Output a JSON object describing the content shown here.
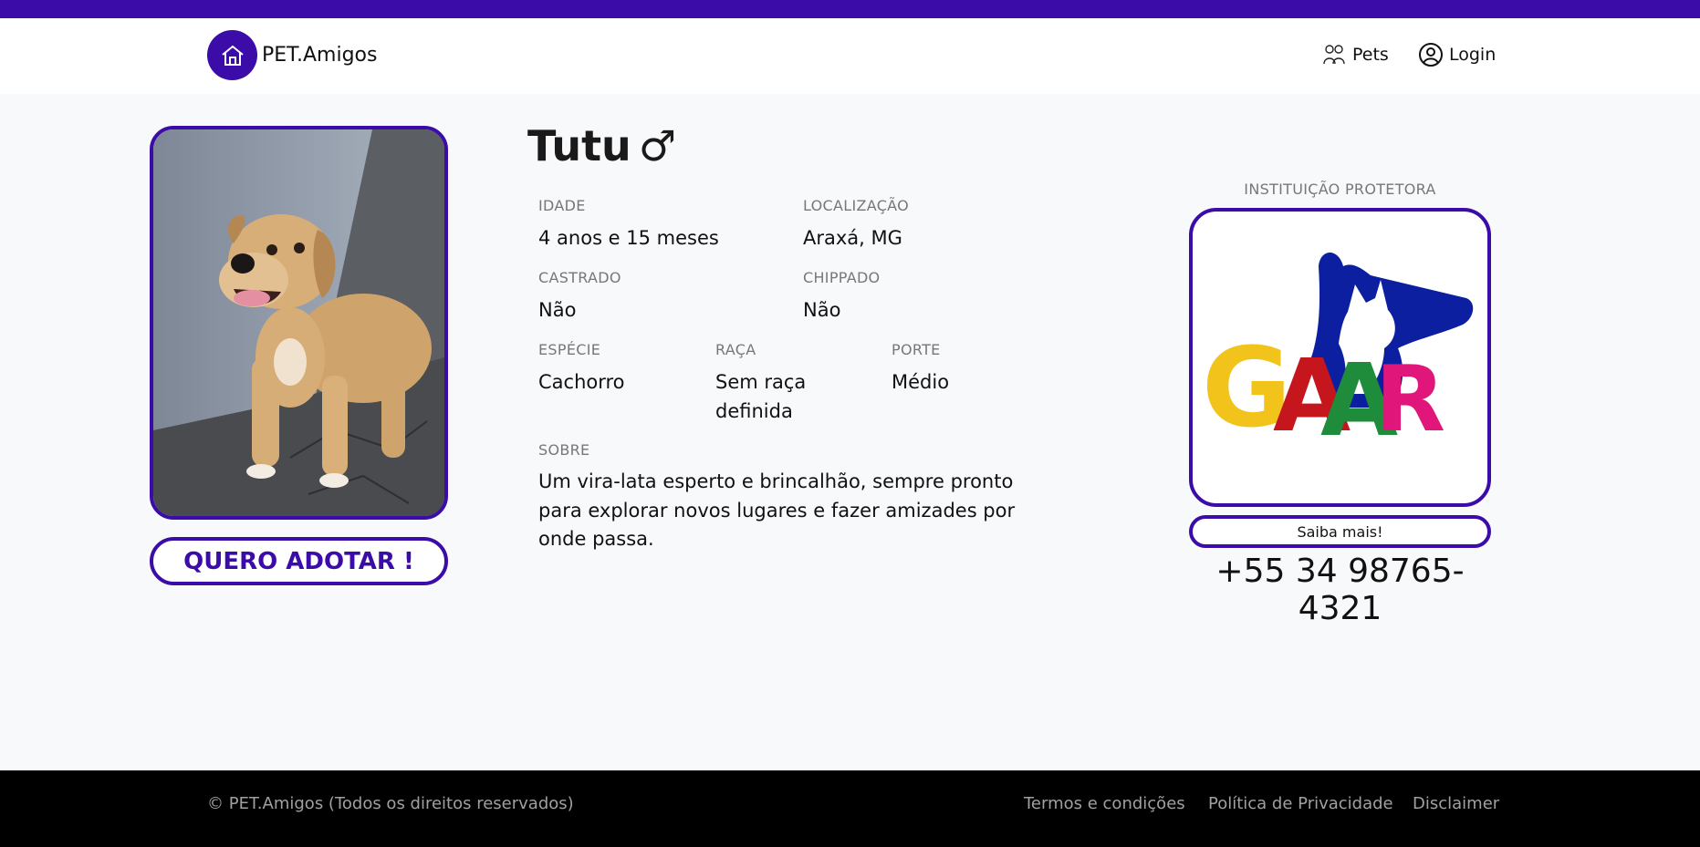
{
  "header": {
    "brand_name": "PET.Amigos",
    "nav": {
      "pets_label": "Pets",
      "login_label": "Login"
    }
  },
  "pet": {
    "name": "Tutu",
    "sex_symbol": "♂",
    "adopt_button": "QUERO ADOTAR !",
    "fields": {
      "idade": {
        "label": "IDADE",
        "value": "4 anos e 15 meses"
      },
      "localizacao": {
        "label": "LOCALIZAÇÃO",
        "value": "Araxá, MG"
      },
      "castrado": {
        "label": "CASTRADO",
        "value": "Não"
      },
      "chippado": {
        "label": "CHIPPADO",
        "value": "Não"
      },
      "especie": {
        "label": "ESPÉCIE",
        "value": "Cachorro"
      },
      "raca": {
        "label": "RAÇA",
        "value_line1": "Sem raça",
        "value_line2": "definida"
      },
      "porte": {
        "label": "PORTE",
        "value": "Médio"
      },
      "sobre": {
        "label": "SOBRE",
        "line1": "Um vira-lata esperto e brincalhão, sempre pronto",
        "line2": "para explorar novos lugares e fazer amizades por",
        "line3": "onde passa."
      }
    }
  },
  "institution": {
    "title": "INSTITUIÇÃO PROTETORA",
    "logo_text": "GAAR",
    "more_button": "Saiba mais!",
    "phone": "+55 34 98765-4321"
  },
  "footer": {
    "copyright": "© PET.Amigos (Todos os direitos reservados)",
    "links": {
      "terms": "Termos e condições",
      "privacy": "Política de Privacidade",
      "disclaimer": "Disclaimer"
    }
  },
  "colors": {
    "primary": "#3b0ca8",
    "footer_bg": "#000000",
    "page_bg": "#f8f9fa"
  }
}
